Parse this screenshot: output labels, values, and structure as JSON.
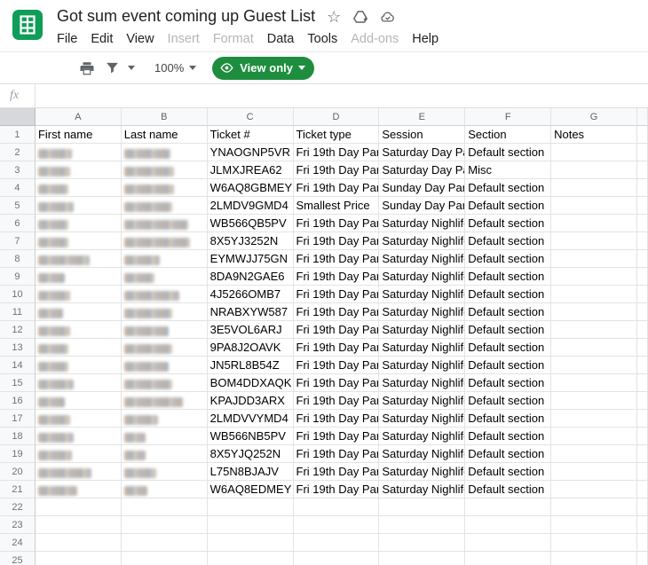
{
  "titlebar": {
    "title": "Got sum event coming up Guest List",
    "icons": [
      "star-icon",
      "drive-shortcut-icon",
      "cloud-saved-icon"
    ]
  },
  "menus": [
    {
      "label": "File",
      "enabled": true
    },
    {
      "label": "Edit",
      "enabled": true
    },
    {
      "label": "View",
      "enabled": true
    },
    {
      "label": "Insert",
      "enabled": false
    },
    {
      "label": "Format",
      "enabled": false
    },
    {
      "label": "Data",
      "enabled": true
    },
    {
      "label": "Tools",
      "enabled": true
    },
    {
      "label": "Add-ons",
      "enabled": false
    },
    {
      "label": "Help",
      "enabled": true
    }
  ],
  "toolbar": {
    "zoom_level": "100%",
    "view_only_label": "View only"
  },
  "formula_bar": {
    "fx_label": "fx"
  },
  "colors": {
    "sheets_green": "#0f9d58",
    "button_green": "#1e8e3e"
  },
  "sheet": {
    "column_letters": [
      "A",
      "B",
      "C",
      "D",
      "E",
      "F",
      "G"
    ],
    "header_row": [
      "First name",
      "Last name",
      "Ticket #",
      "Ticket type",
      "Session",
      "Section",
      "Notes"
    ],
    "rows": [
      {
        "n": 2,
        "fw": 38,
        "lw": 52,
        "ticket": "YNAOGNP5VR",
        "type": "Fri 19th Day Par",
        "session": "Saturday Day Pa",
        "section": "Default section"
      },
      {
        "n": 3,
        "fw": 36,
        "lw": 56,
        "ticket": "JLMXJREA62",
        "type": "Fri 19th Day Par",
        "session": "Saturday Day Pa",
        "section": "Misc"
      },
      {
        "n": 4,
        "fw": 34,
        "lw": 56,
        "ticket": "W6AQ8GBMEY",
        "type": "Fri 19th Day Par",
        "session": "Sunday Day Par",
        "section": "Default section"
      },
      {
        "n": 5,
        "fw": 40,
        "lw": 54,
        "ticket": "2LMDV9GMD4",
        "type": "Smallest Price",
        "session": "Sunday Day Par",
        "section": "Default section"
      },
      {
        "n": 6,
        "fw": 34,
        "lw": 72,
        "ticket": "WB566QB5PV",
        "type": "Fri 19th Day Par",
        "session": "Saturday Nighlife",
        "section": "Default section"
      },
      {
        "n": 7,
        "fw": 34,
        "lw": 74,
        "ticket": "8X5YJ3252N",
        "type": "Fri 19th Day Par",
        "session": "Saturday Nighlife",
        "section": "Default section"
      },
      {
        "n": 8,
        "fw": 58,
        "lw": 40,
        "ticket": "EYMWJJ75GN",
        "type": "Fri 19th Day Par",
        "session": "Saturday Nighlife",
        "section": "Default section"
      },
      {
        "n": 9,
        "fw": 30,
        "lw": 34,
        "ticket": "8DA9N2GAE6",
        "type": "Fri 19th Day Par",
        "session": "Saturday Nighlife",
        "section": "Default section"
      },
      {
        "n": 10,
        "fw": 36,
        "lw": 62,
        "ticket": "4J5266OMB7",
        "type": "Fri 19th Day Par",
        "session": "Saturday Nighlife",
        "section": "Default section"
      },
      {
        "n": 11,
        "fw": 28,
        "lw": 54,
        "ticket": "NRABXYW587",
        "type": "Fri 19th Day Par",
        "session": "Saturday Nighlife",
        "section": "Default section"
      },
      {
        "n": 12,
        "fw": 36,
        "lw": 50,
        "ticket": "3E5VOL6ARJ",
        "type": "Fri 19th Day Par",
        "session": "Saturday Nighlife",
        "section": "Default section"
      },
      {
        "n": 13,
        "fw": 34,
        "lw": 54,
        "ticket": "9PA8J2OAVK",
        "type": "Fri 19th Day Par",
        "session": "Saturday Nighlife",
        "section": "Default section"
      },
      {
        "n": 14,
        "fw": 34,
        "lw": 50,
        "ticket": "JN5RL8B54Z",
        "type": "Fri 19th Day Par",
        "session": "Saturday Nighlife",
        "section": "Default section"
      },
      {
        "n": 15,
        "fw": 40,
        "lw": 54,
        "ticket": "BOM4DDXAQK",
        "type": "Fri 19th Day Par",
        "session": "Saturday Nighlife",
        "section": "Default section"
      },
      {
        "n": 16,
        "fw": 30,
        "lw": 66,
        "ticket": "KPAJDD3ARX",
        "type": "Fri 19th Day Par",
        "session": "Saturday Nighlife",
        "section": "Default section"
      },
      {
        "n": 17,
        "fw": 36,
        "lw": 38,
        "ticket": "2LMDVVYMD4",
        "type": "Fri 19th Day Par",
        "session": "Saturday Nighlife",
        "section": "Default section"
      },
      {
        "n": 18,
        "fw": 40,
        "lw": 24,
        "ticket": "WB566NB5PV",
        "type": "Fri 19th Day Par",
        "session": "Saturday Nighlife",
        "section": "Default section"
      },
      {
        "n": 19,
        "fw": 38,
        "lw": 24,
        "ticket": "8X5YJQ252N",
        "type": "Fri 19th Day Par",
        "session": "Saturday Nighlife",
        "section": "Default section"
      },
      {
        "n": 20,
        "fw": 60,
        "lw": 36,
        "ticket": "L75N8BJAJV",
        "type": "Fri 19th Day Par",
        "session": "Saturday Nighlife",
        "section": "Default section"
      },
      {
        "n": 21,
        "fw": 44,
        "lw": 26,
        "ticket": "W6AQ8EDMEY",
        "type": "Fri 19th Day Par",
        "session": "Saturday Nighlife",
        "section": "Default section"
      }
    ],
    "empty_row_numbers": [
      22,
      23,
      24,
      25
    ]
  }
}
